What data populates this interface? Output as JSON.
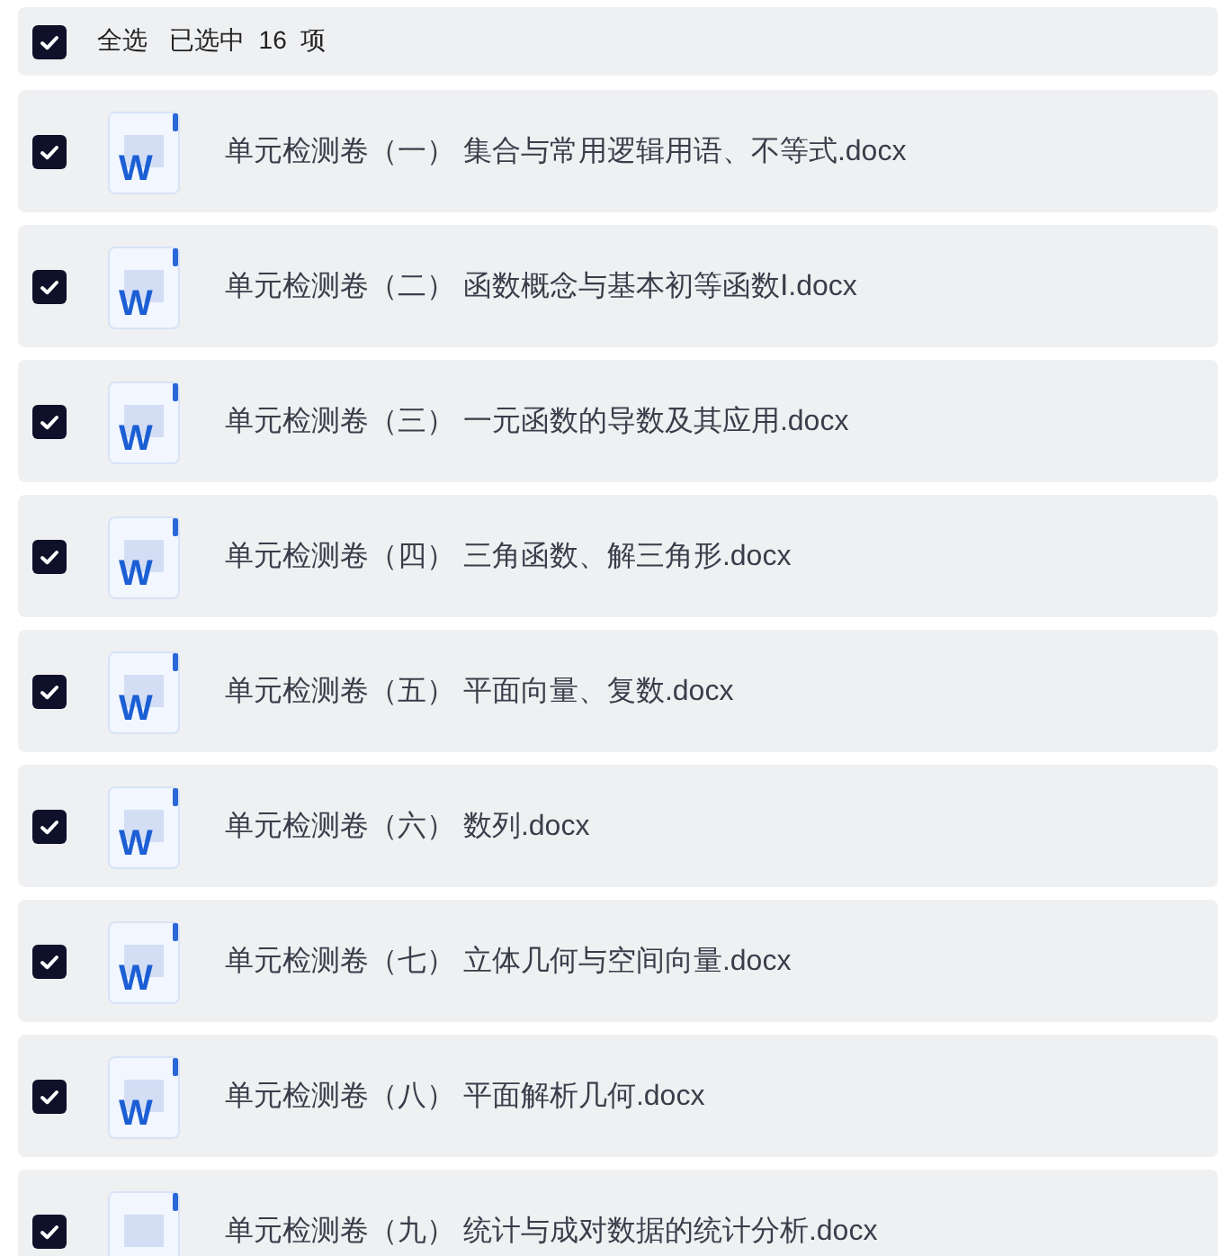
{
  "header": {
    "select_all": {
      "label": "全选",
      "checked": true
    },
    "selection_count": "已选中  16  项"
  },
  "files": [
    {
      "name": "单元检测卷（一） 集合与常用逻辑用语、不等式.docx",
      "icon_text": "W",
      "checked": true
    },
    {
      "name": "单元检测卷（二） 函数概念与基本初等函数Ⅰ.docx",
      "icon_text": "W",
      "checked": true
    },
    {
      "name": "单元检测卷（三） 一元函数的导数及其应用.docx",
      "icon_text": "W",
      "checked": true
    },
    {
      "name": "单元检测卷（四） 三角函数、解三角形.docx",
      "icon_text": "W",
      "checked": true
    },
    {
      "name": "单元检测卷（五） 平面向量、复数.docx",
      "icon_text": "W",
      "checked": true
    },
    {
      "name": "单元检测卷（六） 数列.docx",
      "icon_text": "W",
      "checked": true
    },
    {
      "name": "单元检测卷（七） 立体几何与空间向量.docx",
      "icon_text": "W",
      "checked": true
    },
    {
      "name": "单元检测卷（八） 平面解析几何.docx",
      "icon_text": "W",
      "checked": true
    },
    {
      "name": "单元检测卷（九） 统计与成对数据的统计分析.docx",
      "checked": true
    }
  ]
}
